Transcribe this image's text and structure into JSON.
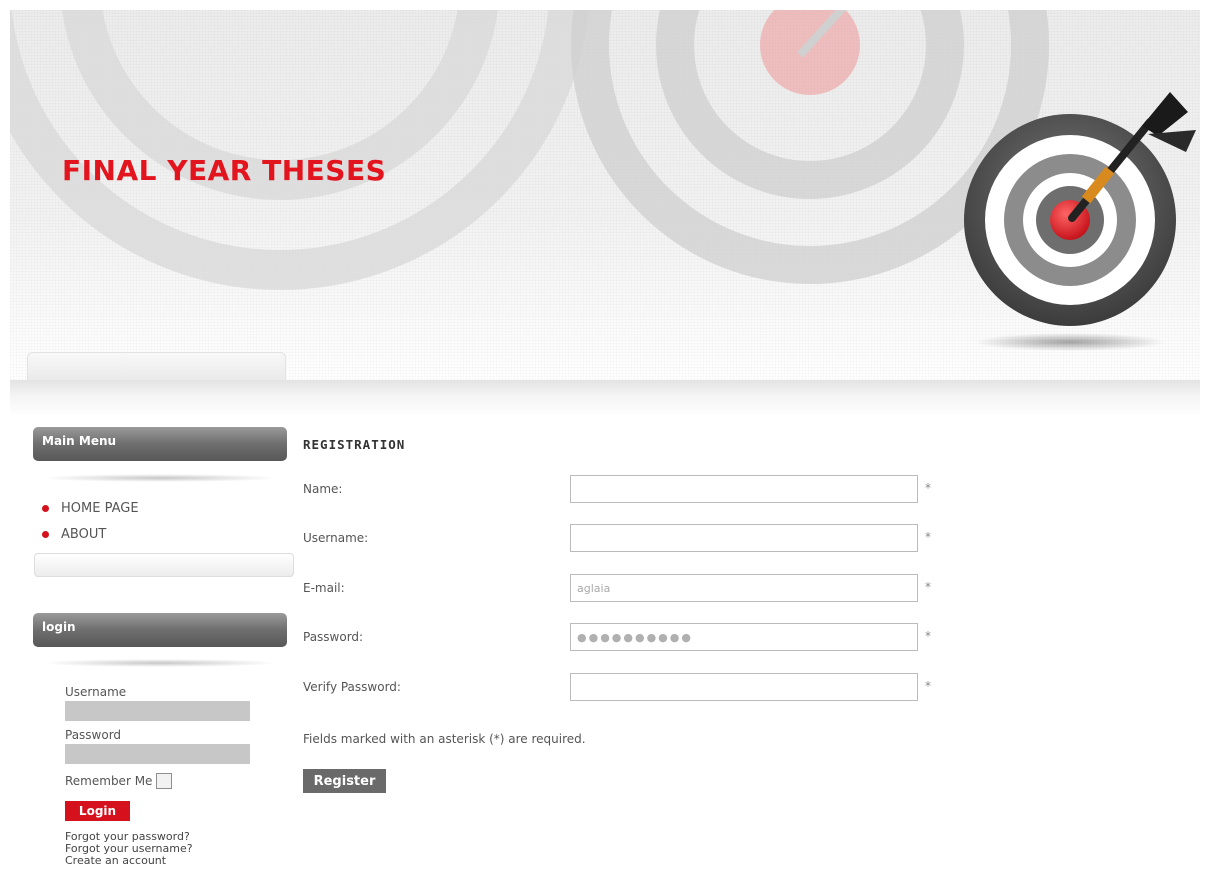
{
  "site": {
    "title": "FINAL YEAR THESES",
    "accent_color": "#e2141d",
    "logo": "target-dart-icon"
  },
  "sidebar": {
    "main_menu": {
      "title": "Main Menu",
      "items": [
        {
          "label": "HOME PAGE",
          "icon": "red-bullet-icon"
        },
        {
          "label": "ABOUT",
          "icon": "red-bullet-icon"
        }
      ]
    },
    "login": {
      "title": "login",
      "username_label": "Username",
      "username_value": "",
      "password_label": "Password",
      "password_value": "",
      "remember_label": "Remember Me",
      "remember_checked": false,
      "login_button": "Login",
      "links": [
        "Forgot your password?",
        "Forgot your username?",
        "Create an account"
      ]
    }
  },
  "registration": {
    "title": "REGISTRATION",
    "fields": [
      {
        "label": "Name:",
        "value": "",
        "type": "text",
        "required_mark": "*"
      },
      {
        "label": "Username:",
        "value": "",
        "type": "text",
        "required_mark": "*"
      },
      {
        "label": "E-mail:",
        "value": "aglaia",
        "type": "text",
        "required_mark": "*"
      },
      {
        "label": "Password:",
        "value": "●●●●●●●●●●",
        "type": "password",
        "required_mark": "*"
      },
      {
        "label": "Verify Password:",
        "value": "",
        "type": "password",
        "required_mark": "*"
      }
    ],
    "required_note": "Fields marked with an asterisk (*) are required.",
    "register_button": "Register"
  }
}
